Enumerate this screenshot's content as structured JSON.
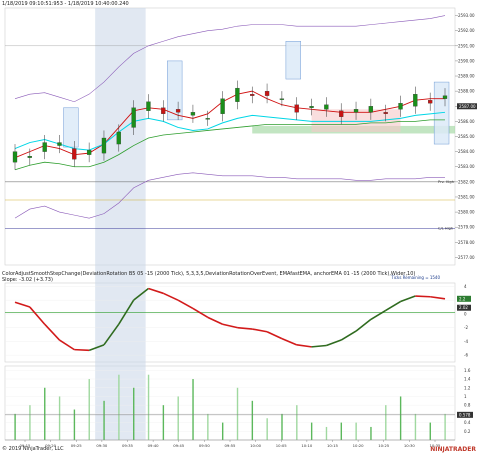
{
  "header": {
    "instrument_line": "1/18/2019 09:10:51:953 - 1/18/2019 10:40:00.240"
  },
  "indicator_header": "ColorAdjustSmoothStepChange(DeviationRotation B5 05 -15 (2000 Tick), 5,3,3,5,DeviationRotationOverEvent, EMAfastEMA, anchorEMA 01 -15 (2000 Tick),Wider,10)",
  "indicator_subheader": "Slope: -3.02 (+3.73)",
  "footer": {
    "copyright": "© 2019 NinjaTrader, LLC",
    "logo": "NINJATRADER"
  },
  "price_axis": {
    "ticks": [
      "2593.00",
      "2592.00",
      "2591.00",
      "2590.00",
      "2589.00",
      "2588.00",
      "2587.00",
      "2586.00",
      "2585.00",
      "2584.00",
      "2583.00",
      "2582.00",
      "2581.00",
      "2580.00",
      "2579.00",
      "2578.00",
      "2577.00"
    ],
    "last_price": "2587.00"
  },
  "ind_axis": {
    "ticks": [
      "4",
      "2",
      "0",
      "-2",
      "-4",
      "-6"
    ],
    "value_badge_top": "2.2",
    "value_badge_bottom": "2.02"
  },
  "vol_axis": {
    "ticks": [
      "1.6",
      "1.4",
      "1.2",
      "1",
      "0.8",
      "0.6",
      "0.4",
      "0.2"
    ],
    "value_badge": "0.578"
  },
  "time_axis": [
    "09:15",
    "09:20",
    "09:25",
    "09:30",
    "09:35",
    "09:40",
    "09:45",
    "09:50",
    "09:55",
    "10:00",
    "10:05",
    "10:10",
    "10:15",
    "10:20",
    "10:25",
    "10:30",
    "10:35"
  ],
  "labels": {
    "prev_high": "Prv. High",
    "ctl_high": "C/L High",
    "ticks_remaining": "Ticks Remaining = 1540"
  },
  "colors": {
    "candle_up": "#1a8f1a",
    "candle_down": "#c81414",
    "vwap": "#00d6e6",
    "envelope": "#8a5ab8",
    "green_line": "#2e9e2e",
    "red_line": "#d01010",
    "sma": "#5a7d2a",
    "highlight": "#c9d6e8"
  },
  "chart_data": [
    {
      "type": "line",
      "title": "",
      "xlabel": "",
      "ylabel": "",
      "ylim": [
        2576.5,
        2593.5
      ],
      "x": [
        "09:12",
        "09:15",
        "09:18",
        "09:21",
        "09:24",
        "09:27",
        "09:30",
        "09:33",
        "09:36",
        "09:39",
        "09:42",
        "09:45",
        "09:48",
        "09:51",
        "09:54",
        "09:57",
        "10:00",
        "10:03",
        "10:06",
        "10:09",
        "10:12",
        "10:15",
        "10:18",
        "10:21",
        "10:24",
        "10:27",
        "10:30",
        "10:33",
        "10:36",
        "10:39"
      ],
      "series": [
        {
          "values": [
            2583.6,
            2584.0,
            2584.4,
            2584.2,
            2583.8,
            2583.9,
            2584.5,
            2585.6,
            2586.7,
            2586.9,
            2586.8,
            2586.4,
            2586.2,
            2586.5,
            2587.3,
            2587.8,
            2588.0,
            2587.5,
            2587.1,
            2586.9,
            2586.8,
            2586.7,
            2586.6,
            2586.6,
            2586.6,
            2586.8,
            2587.0,
            2587.4,
            2587.5,
            2587.5
          ]
        },
        {
          "values": [
            2584.2,
            2584.6,
            2584.8,
            2584.5,
            2584.2,
            2584.1,
            2584.5,
            2585.3,
            2586.0,
            2586.2,
            2586.0,
            2585.6,
            2585.4,
            2585.5,
            2585.9,
            2586.2,
            2586.4,
            2586.3,
            2586.2,
            2586.1,
            2586.0,
            2586.0,
            2586.0,
            2586.0,
            2586.0,
            2586.1,
            2586.2,
            2586.4,
            2586.5,
            2586.6
          ]
        },
        {
          "values": [
            2582.8,
            2583.1,
            2583.3,
            2583.2,
            2583.0,
            2583.0,
            2583.3,
            2583.8,
            2584.4,
            2584.9,
            2585.1,
            2585.2,
            2585.3,
            2585.4,
            2585.5,
            2585.6,
            2585.7,
            2585.8,
            2585.8,
            2585.8,
            2585.8,
            2585.8,
            2585.8,
            2585.8,
            2585.9,
            2585.9,
            2586.0,
            2586.0,
            2586.1,
            2586.1
          ]
        },
        {
          "values": [
            2587.5,
            2587.8,
            2587.9,
            2587.6,
            2587.3,
            2587.8,
            2588.6,
            2589.6,
            2590.5,
            2591.0,
            2591.3,
            2591.6,
            2591.8,
            2592.0,
            2592.1,
            2592.3,
            2592.4,
            2592.4,
            2592.4,
            2592.3,
            2592.3,
            2592.3,
            2592.3,
            2592.3,
            2592.4,
            2592.5,
            2592.6,
            2592.7,
            2592.8,
            2593.0
          ]
        },
        {
          "values": [
            2579.6,
            2580.2,
            2580.4,
            2580.0,
            2579.8,
            2579.6,
            2579.9,
            2580.6,
            2581.6,
            2582.1,
            2582.3,
            2582.5,
            2582.6,
            2582.5,
            2582.4,
            2582.4,
            2582.4,
            2582.3,
            2582.3,
            2582.2,
            2582.2,
            2582.2,
            2582.2,
            2582.1,
            2582.1,
            2582.2,
            2582.2,
            2582.2,
            2582.3,
            2582.3
          ]
        }
      ]
    },
    {
      "type": "line",
      "title": "",
      "ylim": [
        -7,
        4.5
      ],
      "x": [
        "09:12",
        "09:15",
        "09:18",
        "09:21",
        "09:24",
        "09:27",
        "09:30",
        "09:33",
        "09:36",
        "09:39",
        "09:42",
        "09:45",
        "09:48",
        "09:51",
        "09:54",
        "09:57",
        "10:00",
        "10:03",
        "10:06",
        "10:09",
        "10:12",
        "10:15",
        "10:18",
        "10:21",
        "10:24",
        "10:27",
        "10:30",
        "10:33",
        "10:36",
        "10:39"
      ],
      "series": [
        {
          "values": [
            1.7,
            1.0,
            -1.5,
            -3.8,
            -5.2,
            -5.3,
            -4.5,
            -1.5,
            2.0,
            3.7,
            3.0,
            2.0,
            0.8,
            -0.5,
            -1.5,
            -2.0,
            -2.2,
            -2.6,
            -3.6,
            -4.5,
            -4.8,
            -4.6,
            -3.8,
            -2.5,
            -0.8,
            0.5,
            1.8,
            2.6,
            2.5,
            2.2
          ]
        },
        {
          "values": [
            0.2,
            0.2,
            0.2,
            0.2,
            0.2,
            0.2,
            0.3,
            0.3,
            0.3,
            0.4,
            0.4,
            0.4,
            0.4,
            0.4,
            0.4,
            0.5,
            0.5,
            0.5,
            0.5,
            0.6,
            0.6,
            0.6,
            0.7,
            0.8,
            0.9,
            1.0,
            1.1,
            1.2,
            1.3,
            1.3
          ]
        }
      ]
    },
    {
      "type": "bar",
      "title": "",
      "ylim": [
        0,
        1.7
      ],
      "categories": [
        "09:12",
        "09:15",
        "09:18",
        "09:21",
        "09:24",
        "09:27",
        "09:30",
        "09:33",
        "09:36",
        "09:39",
        "09:42",
        "09:45",
        "09:48",
        "09:51",
        "09:54",
        "09:57",
        "10:00",
        "10:03",
        "10:06",
        "10:09",
        "10:12",
        "10:15",
        "10:18",
        "10:21",
        "10:24",
        "10:27",
        "10:30",
        "10:33",
        "10:36",
        "10:39"
      ],
      "values": [
        0.6,
        0.8,
        1.2,
        1.0,
        0.7,
        1.4,
        0.9,
        1.5,
        1.2,
        1.5,
        0.8,
        1.0,
        1.4,
        0.6,
        0.4,
        1.2,
        0.9,
        0.5,
        0.6,
        0.8,
        0.4,
        0.3,
        0.4,
        0.4,
        0.3,
        0.8,
        1.0,
        0.6,
        0.4,
        0.6
      ]
    }
  ]
}
